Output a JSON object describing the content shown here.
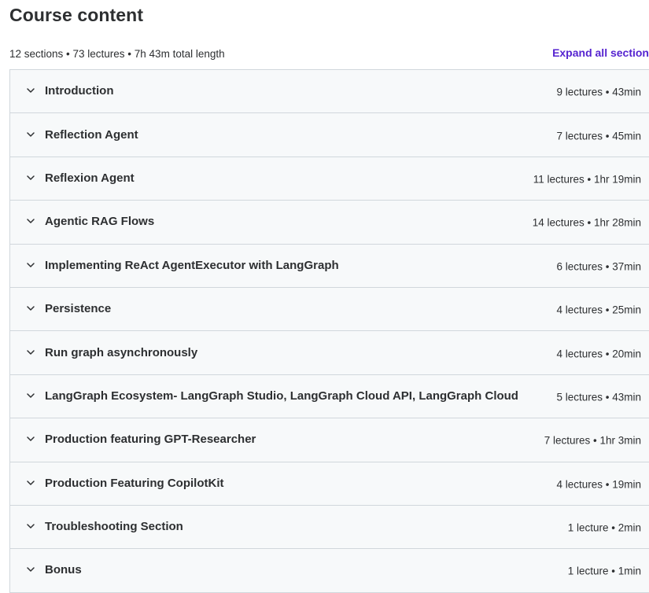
{
  "header": {
    "title": "Course content"
  },
  "summary": {
    "text": "12 sections • 73 lectures • 7h 43m total length",
    "expand_all_label": "Expand all section"
  },
  "sections": [
    {
      "title": "Introduction",
      "meta": "9 lectures • 43min"
    },
    {
      "title": "Reflection Agent",
      "meta": "7 lectures • 45min"
    },
    {
      "title": "Reflexion Agent",
      "meta": "11 lectures • 1hr 19min"
    },
    {
      "title": "Agentic RAG Flows",
      "meta": "14 lectures • 1hr 28min"
    },
    {
      "title": "Implementing ReAct AgentExecutor with LangGraph",
      "meta": "6 lectures • 37min"
    },
    {
      "title": "Persistence",
      "meta": "4 lectures • 25min"
    },
    {
      "title": "Run graph asynchronously",
      "meta": "4 lectures • 20min"
    },
    {
      "title": "LangGraph Ecosystem- LangGraph Studio, LangGraph Cloud API, LangGraph Cloud",
      "meta": "5 lectures • 43min"
    },
    {
      "title": "Production featuring GPT-Researcher",
      "meta": "7 lectures • 1hr 3min"
    },
    {
      "title": "Production Featuring CopilotKit",
      "meta": "4 lectures • 19min"
    },
    {
      "title": "Troubleshooting Section",
      "meta": "1 lecture • 2min"
    },
    {
      "title": "Bonus",
      "meta": "1 lecture • 1min"
    }
  ],
  "colors": {
    "accent": "#5624d0",
    "section_bg": "#f7f9fa",
    "border": "#d1d7dc",
    "text": "#2d2f31"
  },
  "icons": {
    "section_toggle": "chevron-down-icon"
  }
}
